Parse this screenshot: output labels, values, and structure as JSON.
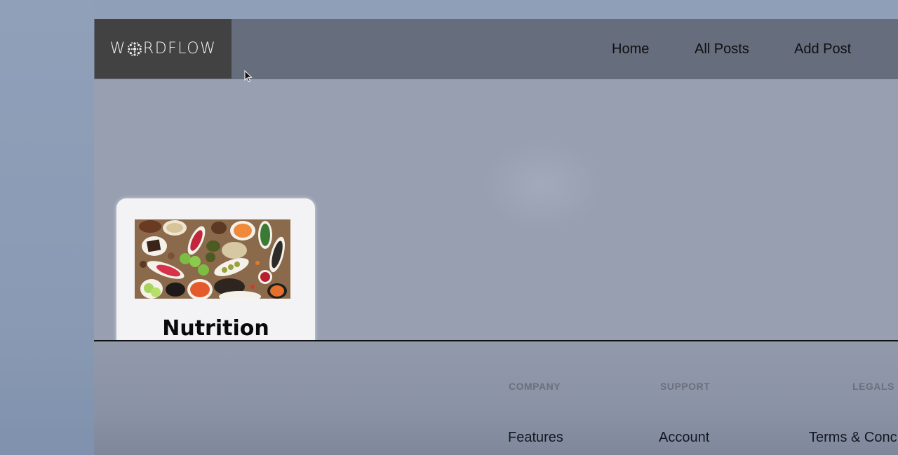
{
  "brand": {
    "logo_text_left": "W",
    "logo_text_right": "RDFLOW",
    "logo_icon": "flower-icon"
  },
  "nav": {
    "links": [
      {
        "label": "Home"
      },
      {
        "label": "All Posts"
      },
      {
        "label": "Add Post"
      }
    ]
  },
  "posts": [
    {
      "title": "Nutrition",
      "image_icon": "healthy-food-photo"
    }
  ],
  "footer": {
    "columns": [
      {
        "heading": "COMPANY",
        "links": [
          "Features"
        ]
      },
      {
        "heading": "SUPPORT",
        "links": [
          "Account"
        ]
      },
      {
        "heading": "LEGALS",
        "links": [
          "Terms & Conc"
        ]
      }
    ]
  },
  "colors": {
    "navbar": "#666d7d",
    "logo_bg": "#424242",
    "content_bg": "#979fb1",
    "card_bg": "#f3f3f5",
    "footer_heading": "#6a707d"
  }
}
